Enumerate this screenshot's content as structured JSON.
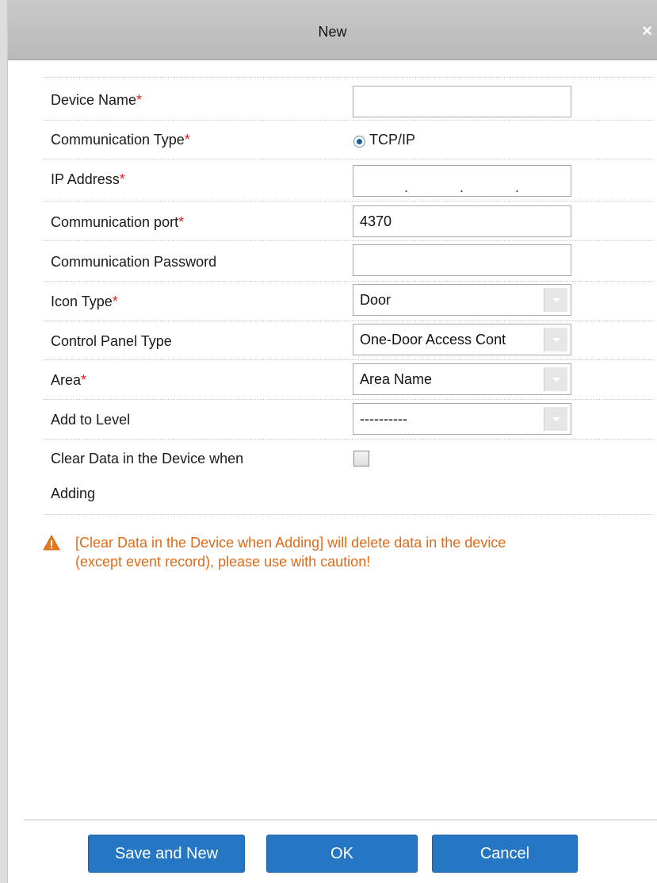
{
  "dialog": {
    "title": "New",
    "close_label": "×"
  },
  "form": {
    "device_name": {
      "label": "Device Name",
      "required_mark": "*",
      "value": ""
    },
    "communication_type": {
      "label": "Communication Type",
      "required_mark": "*",
      "option_label": "TCP/IP",
      "selected": true
    },
    "ip_address": {
      "label": "IP Address",
      "required_mark": "*",
      "separator": "."
    },
    "communication_port": {
      "label": "Communication port",
      "required_mark": "*",
      "value": "4370"
    },
    "communication_password": {
      "label": "Communication Password",
      "value": ""
    },
    "icon_type": {
      "label": "Icon Type",
      "required_mark": "*",
      "selected": "Door"
    },
    "control_panel_type": {
      "label": "Control Panel Type",
      "selected": "One-Door Access Cont"
    },
    "area": {
      "label": "Area",
      "required_mark": "*",
      "selected": "Area Name"
    },
    "add_to_level": {
      "label": "Add to Level",
      "selected": "----------"
    },
    "clear_data": {
      "label_line1": "Clear Data in the Device when",
      "label_line2": "Adding",
      "checked": false
    }
  },
  "warning": {
    "line1": "[Clear Data in the Device when Adding] will delete data in the device",
    "line2": "(except event record), please use with caution!",
    "color": "#e06a16"
  },
  "buttons": {
    "save_and_new": "Save and New",
    "ok": "OK",
    "cancel": "Cancel"
  },
  "colors": {
    "accent": "#2577c4",
    "required": "#e02020",
    "title_bar": "#c2c2c2"
  }
}
